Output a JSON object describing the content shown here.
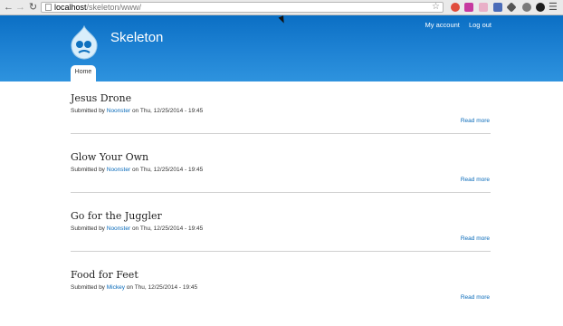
{
  "browser": {
    "url_host": "localhost",
    "url_path": "/skeleton/www/",
    "icons": [
      "back-icon",
      "forward-icon",
      "reload-icon",
      "star-icon",
      "menu-icon"
    ]
  },
  "header": {
    "site_name": "Skeleton",
    "user_links": [
      "My account",
      "Log out"
    ],
    "tab_home": "Home",
    "colors": {
      "header_top": "#0b6fc4",
      "header_bottom": "#2e93de",
      "link": "#0a6bba"
    }
  },
  "nodes": [
    {
      "title": "Jesus Drone",
      "submitted_prefix": "Submitted by",
      "author": "Noonster",
      "date": "on Thu, 12/25/2014 - 19:45",
      "read_more": "Read more"
    },
    {
      "title": "Glow Your Own",
      "submitted_prefix": "Submitted by",
      "author": "Noonster",
      "date": "on Thu, 12/25/2014 - 19:45",
      "read_more": "Read more"
    },
    {
      "title": "Go for the Juggler",
      "submitted_prefix": "Submitted by",
      "author": "Noonster",
      "date": "on Thu, 12/25/2014 - 19:45",
      "read_more": "Read more"
    },
    {
      "title": "Food for Feet",
      "submitted_prefix": "Submitted by",
      "author": "Mickey",
      "date": "on Thu, 12/25/2014 - 19:45",
      "read_more": "Read more"
    }
  ]
}
